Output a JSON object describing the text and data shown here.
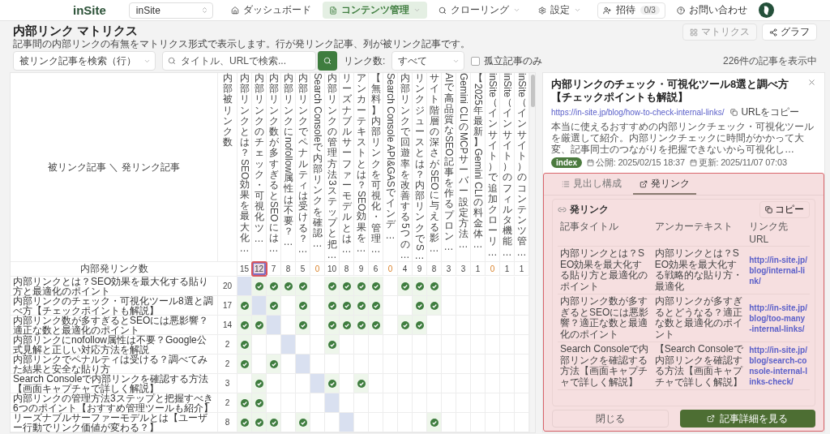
{
  "nav": {
    "logo": "inSite",
    "site_select": "inSite",
    "items": [
      {
        "label": "ダッシュボード",
        "selected": false,
        "dropdown": false
      },
      {
        "label": "コンテンツ管理",
        "selected": true,
        "dropdown": true
      },
      {
        "label": "クローリング",
        "selected": false,
        "dropdown": true
      },
      {
        "label": "設定",
        "selected": false,
        "dropdown": true
      }
    ],
    "invite": {
      "label": "招待",
      "count": "0/3"
    },
    "contact": "お問い合わせ"
  },
  "header": {
    "title": "内部リンク マトリクス",
    "description": "記事間の内部リンクの有無をマトリクス形式で表示します。行が発リンク記事、列が被リンク記事です。",
    "view_buttons": [
      {
        "label": "マトリクス",
        "selected": true
      },
      {
        "label": "グラフ",
        "selected": false
      }
    ]
  },
  "filters": {
    "row_select": "被リンク記事を検索（行）",
    "search": {
      "placeholder": "タイトル、URLで検索..."
    },
    "count_label": "リンク数:",
    "count_select": "すべて",
    "orphan": {
      "label": "孤立記事のみ",
      "checked": false
    },
    "result": "226件の記事を表示中"
  },
  "matrix": {
    "corner": "被リンク記事 ＼ 発リンク記事",
    "count_header": "内部被リンク数",
    "columns": [
      "内部リンクとは？SEO効果を最大化…",
      "内部リンクのチェック・可視化ツ…",
      "内部リンク数が多すぎるとSEOには…",
      "内部リンクにnofollow属性は不要？…",
      "内部リンクでペナルティは受ける？…",
      "Search Consoleで内部リンクを確認…",
      "内部リンクの管理方法3ステップと把…",
      "リーズナブルサーファーモデルとは…",
      "アンカーテキストとは？SEO効果を…",
      "【無料】内部リンクを可視化・管理…",
      "Search Console API&GASでインデ…",
      "内部リンクで回遊率を改善する5つの…",
      "リンクジュースとは？内部リンクでS…",
      "サイト階層の深さがSEOに与える影…",
      "AIで高品質なSEO記事を作るプロン…",
      "Gemini CLIのMCPサーバー設定方法…",
      "【2025年最新】Gemini CLIの料金体…",
      "inSite（インサイト）で追加クローリ…",
      "inSite（インサイト）のフィルタ機能…",
      "inSite（インサイト）のコンテンツ管…"
    ],
    "totals": {
      "label": "内部発リンク数",
      "values": [
        {
          "value": "15",
          "zero": false,
          "selected": false,
          "highlighted": false
        },
        {
          "value": "12",
          "zero": false,
          "selected": true,
          "highlighted": true
        },
        {
          "value": "7",
          "zero": false,
          "selected": false,
          "highlighted": false
        },
        {
          "value": "8",
          "zero": false,
          "selected": false,
          "highlighted": false
        },
        {
          "value": "5",
          "zero": false,
          "selected": false,
          "highlighted": false
        },
        {
          "value": "0",
          "zero": true,
          "selected": false,
          "highlighted": false
        },
        {
          "value": "10",
          "zero": false,
          "selected": false,
          "highlighted": false
        },
        {
          "value": "8",
          "zero": false,
          "selected": false,
          "highlighted": false
        },
        {
          "value": "9",
          "zero": false,
          "selected": false,
          "highlighted": false
        },
        {
          "value": "6",
          "zero": false,
          "selected": false,
          "highlighted": false
        },
        {
          "value": "0",
          "zero": true,
          "selected": false,
          "highlighted": false
        },
        {
          "value": "4",
          "zero": false,
          "selected": false,
          "highlighted": false
        },
        {
          "value": "9",
          "zero": false,
          "selected": false,
          "highlighted": false
        },
        {
          "value": "8",
          "zero": false,
          "selected": false,
          "highlighted": false
        },
        {
          "value": "3",
          "zero": false,
          "selected": false,
          "highlighted": false
        },
        {
          "value": "3",
          "zero": false,
          "selected": false,
          "highlighted": false
        },
        {
          "value": "1",
          "zero": false,
          "selected": false,
          "highlighted": false
        },
        {
          "value": "0",
          "zero": true,
          "selected": false,
          "highlighted": false
        },
        {
          "value": "1",
          "zero": false,
          "selected": false,
          "highlighted": false
        },
        {
          "value": "1",
          "zero": false,
          "selected": false,
          "highlighted": false
        }
      ]
    },
    "rows": [
      {
        "title": "内部リンクとは？SEO効果を最大化する貼り方と最適化のポイント",
        "count": "20",
        "cells": [
          {
            "linked": false,
            "self": true
          },
          {
            "linked": true,
            "self": false
          },
          {
            "linked": true,
            "self": false
          },
          {
            "linked": true,
            "self": false
          },
          {
            "linked": true,
            "self": false
          },
          {
            "linked": false,
            "self": false
          },
          {
            "linked": true,
            "self": false
          },
          {
            "linked": true,
            "self": false
          },
          {
            "linked": true,
            "self": false
          },
          {
            "linked": true,
            "self": false
          },
          {
            "linked": false,
            "self": false
          },
          {
            "linked": true,
            "self": false
          },
          {
            "linked": true,
            "self": false
          },
          {
            "linked": true,
            "self": false
          },
          {
            "linked": false,
            "self": false
          },
          {
            "linked": false,
            "self": false
          },
          {
            "linked": false,
            "self": false
          },
          {
            "linked": false,
            "self": false
          },
          {
            "linked": false,
            "self": false
          },
          {
            "linked": false,
            "self": false
          }
        ]
      },
      {
        "title": "内部リンクのチェック・可視化ツール8選と調べ方【チェックポイントも解説】",
        "count": "17",
        "cells": [
          {
            "linked": true,
            "self": false
          },
          {
            "linked": false,
            "self": true
          },
          {
            "linked": true,
            "self": false
          },
          {
            "linked": false,
            "self": false
          },
          {
            "linked": true,
            "self": false
          },
          {
            "linked": false,
            "self": false
          },
          {
            "linked": true,
            "self": false
          },
          {
            "linked": true,
            "self": false
          },
          {
            "linked": true,
            "self": false
          },
          {
            "linked": true,
            "self": false
          },
          {
            "linked": false,
            "self": false
          },
          {
            "linked": false,
            "self": false
          },
          {
            "linked": true,
            "self": false
          },
          {
            "linked": true,
            "self": false
          },
          {
            "linked": false,
            "self": false
          },
          {
            "linked": false,
            "self": false
          },
          {
            "linked": false,
            "self": false
          },
          {
            "linked": false,
            "self": false
          },
          {
            "linked": false,
            "self": false
          },
          {
            "linked": false,
            "self": false
          }
        ]
      },
      {
        "title": "内部リンク数が多すぎるとSEOには悪影響？適正な数と最適化のポイント",
        "count": "14",
        "cells": [
          {
            "linked": true,
            "self": false
          },
          {
            "linked": true,
            "self": false
          },
          {
            "linked": false,
            "self": true
          },
          {
            "linked": false,
            "self": false
          },
          {
            "linked": true,
            "self": false
          },
          {
            "linked": false,
            "self": false
          },
          {
            "linked": true,
            "self": false
          },
          {
            "linked": true,
            "self": false
          },
          {
            "linked": true,
            "self": false
          },
          {
            "linked": true,
            "self": false
          },
          {
            "linked": false,
            "self": false
          },
          {
            "linked": true,
            "self": false
          },
          {
            "linked": true,
            "self": false
          },
          {
            "linked": false,
            "self": false
          },
          {
            "linked": false,
            "self": false
          },
          {
            "linked": false,
            "self": false
          },
          {
            "linked": false,
            "self": false
          },
          {
            "linked": false,
            "self": false
          },
          {
            "linked": false,
            "self": false
          },
          {
            "linked": false,
            "self": false
          }
        ]
      },
      {
        "title": "内部リンクにnofollow属性は不要？Google公式見解と正しい対応方法を解説",
        "count": "2",
        "cells": [
          {
            "linked": true,
            "self": false
          },
          {
            "linked": false,
            "self": false
          },
          {
            "linked": false,
            "self": false
          },
          {
            "linked": false,
            "self": true
          },
          {
            "linked": false,
            "self": false
          },
          {
            "linked": false,
            "self": false
          },
          {
            "linked": true,
            "self": false
          },
          {
            "linked": false,
            "self": false
          },
          {
            "linked": false,
            "self": false
          },
          {
            "linked": false,
            "self": false
          },
          {
            "linked": false,
            "self": false
          },
          {
            "linked": false,
            "self": false
          },
          {
            "linked": false,
            "self": false
          },
          {
            "linked": false,
            "self": false
          },
          {
            "linked": false,
            "self": false
          },
          {
            "linked": false,
            "self": false
          },
          {
            "linked": false,
            "self": false
          },
          {
            "linked": false,
            "self": false
          },
          {
            "linked": false,
            "self": false
          },
          {
            "linked": false,
            "self": false
          }
        ]
      },
      {
        "title": "内部リンクでペナルティは受ける？調べてみた結果と安全な貼り方",
        "count": "2",
        "cells": [
          {
            "linked": true,
            "self": false
          },
          {
            "linked": false,
            "self": false
          },
          {
            "linked": true,
            "self": false
          },
          {
            "linked": false,
            "self": false
          },
          {
            "linked": false,
            "self": true
          },
          {
            "linked": false,
            "self": false
          },
          {
            "linked": false,
            "self": false
          },
          {
            "linked": false,
            "self": false
          },
          {
            "linked": false,
            "self": false
          },
          {
            "linked": false,
            "self": false
          },
          {
            "linked": false,
            "self": false
          },
          {
            "linked": false,
            "self": false
          },
          {
            "linked": false,
            "self": false
          },
          {
            "linked": false,
            "self": false
          },
          {
            "linked": false,
            "self": false
          },
          {
            "linked": false,
            "self": false
          },
          {
            "linked": false,
            "self": false
          },
          {
            "linked": false,
            "self": false
          },
          {
            "linked": false,
            "self": false
          },
          {
            "linked": false,
            "self": false
          }
        ]
      },
      {
        "title": "Search Consoleで内部リンクを確認する方法【画面キャプチャで詳しく解説】",
        "count": "3",
        "cells": [
          {
            "linked": false,
            "self": false
          },
          {
            "linked": true,
            "self": false
          },
          {
            "linked": false,
            "self": false
          },
          {
            "linked": false,
            "self": false
          },
          {
            "linked": false,
            "self": false
          },
          {
            "linked": false,
            "self": true
          },
          {
            "linked": true,
            "self": false
          },
          {
            "linked": false,
            "self": false
          },
          {
            "linked": true,
            "self": false
          },
          {
            "linked": false,
            "self": false
          },
          {
            "linked": false,
            "self": false
          },
          {
            "linked": false,
            "self": false
          },
          {
            "linked": false,
            "self": false
          },
          {
            "linked": false,
            "self": false
          },
          {
            "linked": false,
            "self": false
          },
          {
            "linked": false,
            "self": false
          },
          {
            "linked": false,
            "self": false
          },
          {
            "linked": false,
            "self": false
          },
          {
            "linked": false,
            "self": false
          },
          {
            "linked": false,
            "self": false
          }
        ]
      },
      {
        "title": "内部リンクの管理方法3ステップと把握すべき6つのポイント【おすすめ管理ツールも紹介】",
        "count": "2",
        "cells": [
          {
            "linked": true,
            "self": false
          },
          {
            "linked": true,
            "self": false
          },
          {
            "linked": false,
            "self": false
          },
          {
            "linked": false,
            "self": false
          },
          {
            "linked": false,
            "self": false
          },
          {
            "linked": false,
            "self": false
          },
          {
            "linked": false,
            "self": true
          },
          {
            "linked": false,
            "self": false
          },
          {
            "linked": false,
            "self": false
          },
          {
            "linked": false,
            "self": false
          },
          {
            "linked": false,
            "self": false
          },
          {
            "linked": false,
            "self": false
          },
          {
            "linked": false,
            "self": false
          },
          {
            "linked": false,
            "self": false
          },
          {
            "linked": false,
            "self": false
          },
          {
            "linked": false,
            "self": false
          },
          {
            "linked": false,
            "self": false
          },
          {
            "linked": false,
            "self": false
          },
          {
            "linked": false,
            "self": false
          },
          {
            "linked": false,
            "self": false
          }
        ]
      },
      {
        "title": "リーズナブルサーファーモデルとは【ユーザー行動でリンク価値が変わる？】",
        "count": "8",
        "cells": [
          {
            "linked": true,
            "self": false
          },
          {
            "linked": true,
            "self": false
          },
          {
            "linked": true,
            "self": false
          },
          {
            "linked": false,
            "self": false
          },
          {
            "linked": true,
            "self": false
          },
          {
            "linked": false,
            "self": false
          },
          {
            "linked": false,
            "self": false
          },
          {
            "linked": false,
            "self": true
          },
          {
            "linked": false,
            "self": false
          },
          {
            "linked": false,
            "self": false
          },
          {
            "linked": false,
            "self": false
          },
          {
            "linked": false,
            "self": false
          },
          {
            "linked": false,
            "self": false
          },
          {
            "linked": true,
            "self": false
          },
          {
            "linked": false,
            "self": false
          },
          {
            "linked": false,
            "self": false
          },
          {
            "linked": false,
            "self": false
          },
          {
            "linked": false,
            "self": false
          },
          {
            "linked": false,
            "self": false
          },
          {
            "linked": false,
            "self": false
          }
        ]
      }
    ]
  },
  "panel": {
    "title": "内部リンクのチェック・可視化ツール8選と調べ方【チェックポイントも解説】",
    "url": "https://in-site.jp/blog/how-to-check-internal-links/",
    "copy_url": "URLをコピー",
    "description": "本当に使えるおすすめの内部リンクチェック・可視化ツールを厳選して紹介。内部リンクチェックに時間がかかって大変、記事同士のつながりを把握できないから可視化し…",
    "badge": "index",
    "published": "公開: 2025/02/15 18:37",
    "updated": "更新: 2025/11/07 07:03",
    "highlighted": true,
    "tabs": [
      {
        "label": "見出し構成",
        "selected": false
      },
      {
        "label": "発リンク",
        "selected": true
      }
    ],
    "links": {
      "title": "発リンク",
      "copy": "コピー",
      "columns": [
        "記事タイトル",
        "アンカーテキスト",
        "リンク先URL"
      ],
      "rows": [
        {
          "title": "内部リンクとは？SEO効果を最大化する貼り方と最適化のポイント",
          "anchor": "内部リンクとは？SEO効果を最大化する戦略的な貼り方・最適化",
          "url": "http://in-site.jp/blog/internal-link/"
        },
        {
          "title": "内部リンク数が多すぎるとSEOには悪影響？適正な数と最適化のポイント",
          "anchor": "内部リンクが多すぎるとどうなる？適正な数と最適化のポイント",
          "url": "http://in-site.jp/blog/too-many-internal-links/"
        },
        {
          "title": "Search Consoleで内部リンクを確認する方法【画面キャプチャで詳しく解説】",
          "anchor": "【Search Consoleで内部リンクを確認する方法【画面キャプチャで詳しく解説】",
          "url": "http://in-site.jp/blog/search-console-internal-links-check/"
        }
      ]
    },
    "buttons": {
      "close": "閉じる",
      "detail": "記事詳細を見る"
    }
  }
}
